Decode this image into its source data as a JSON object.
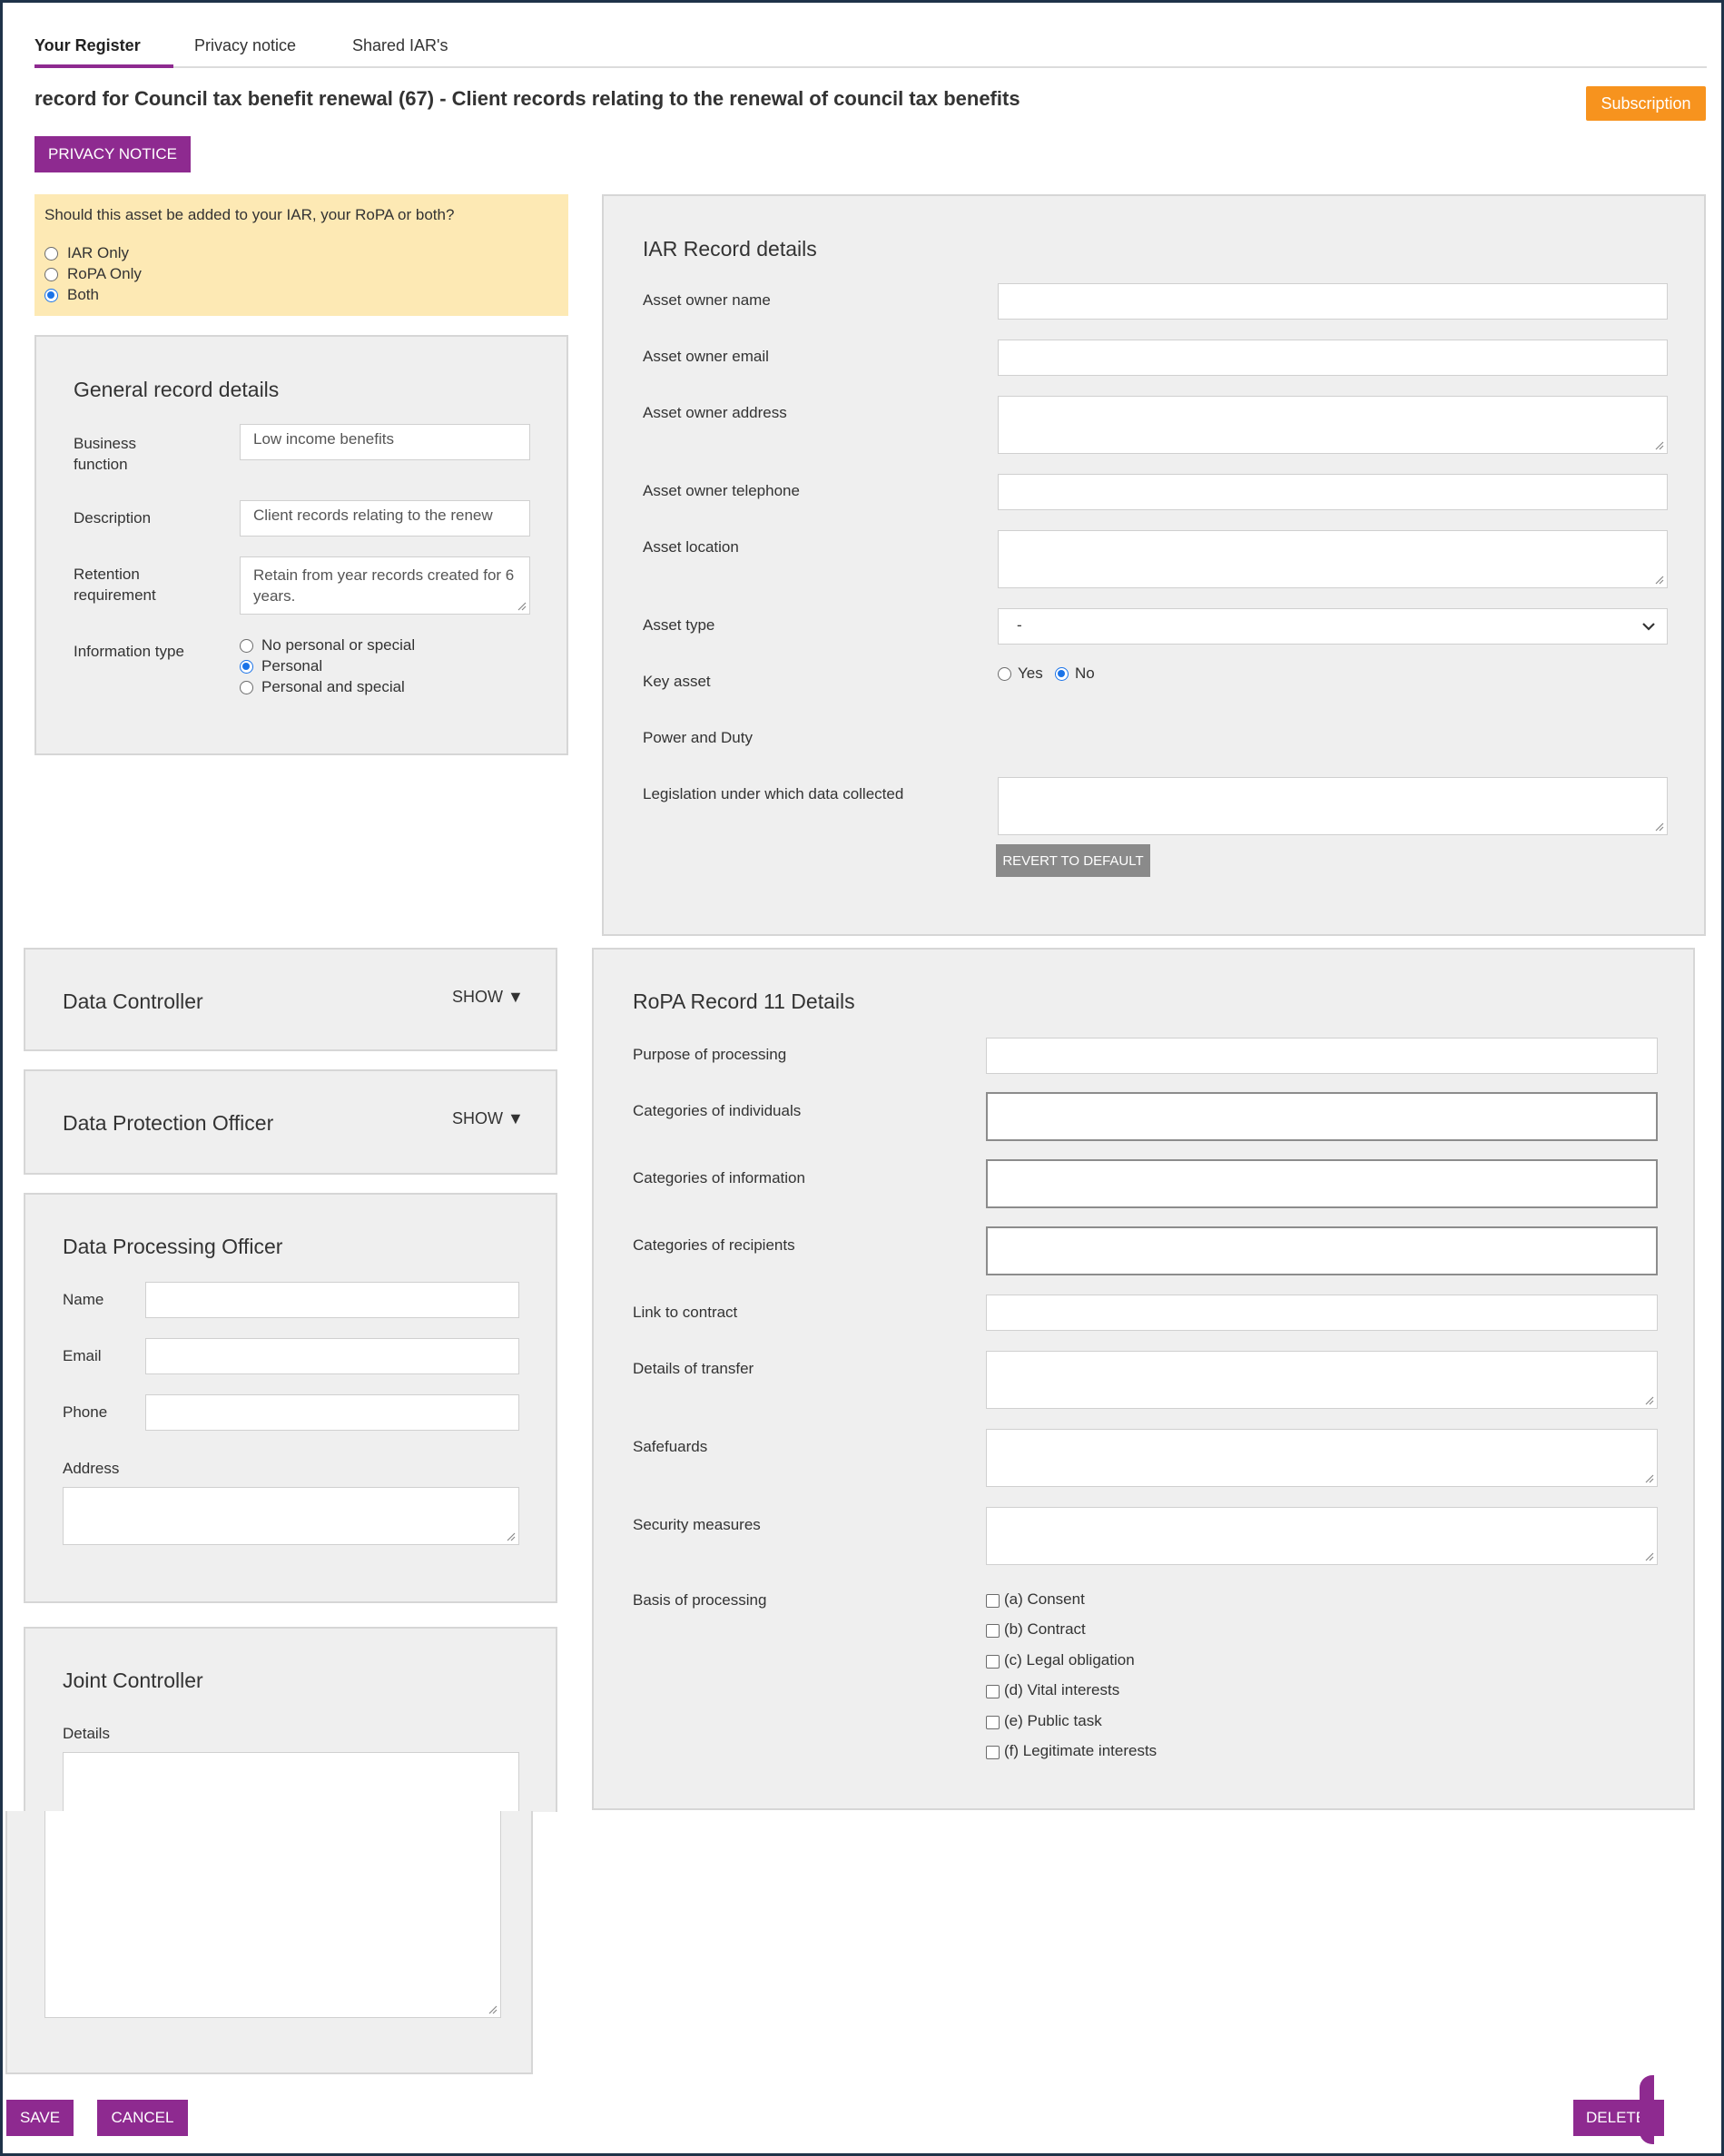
{
  "tabs": [
    "Your Register",
    "Privacy notice",
    "Shared IAR's"
  ],
  "page_title": "record for Council tax benefit renewal (67) - Client records relating to the renewal of council tax benefits",
  "subscription_button": "Subscription",
  "privacy_notice_button": "PRIVACY NOTICE",
  "asset_target": {
    "question": "Should this asset be added to your IAR, your RoPA or both?",
    "options": [
      "IAR Only",
      "RoPA Only",
      "Both"
    ],
    "selected": "Both"
  },
  "general": {
    "title": "General record details",
    "business_function_label": "Business function",
    "business_function_value": "Low income benefits",
    "description_label": "Description",
    "description_value": "Client records relating to the renew",
    "retention_label": "Retention requirement",
    "retention_value": "Retain from year records created for 6 years.",
    "info_type_label": "Information type",
    "info_type_options": [
      "No personal or special",
      "Personal",
      "Personal and special"
    ],
    "info_type_selected": "Personal"
  },
  "iar": {
    "title": "IAR Record details",
    "asset_owner_name": "Asset owner name",
    "asset_owner_email": "Asset owner email",
    "asset_owner_address": "Asset owner address",
    "asset_owner_telephone": "Asset owner telephone",
    "asset_location": "Asset location",
    "asset_type": "Asset type",
    "asset_type_value": "-",
    "key_asset": "Key asset",
    "key_asset_options": [
      "Yes",
      "No"
    ],
    "key_asset_selected": "No",
    "power_and_duty": "Power and Duty",
    "legislation": "Legislation under which data collected",
    "revert_button": "REVERT TO DEFAULT"
  },
  "data_controller": {
    "title": "Data Controller",
    "toggle": "SHOW ▼"
  },
  "dpo": {
    "title": "Data Protection Officer",
    "toggle": "SHOW ▼"
  },
  "processing_officer": {
    "title": "Data Processing Officer",
    "name": "Name",
    "email": "Email",
    "phone": "Phone",
    "address": "Address"
  },
  "joint_controller": {
    "title": "Joint Controller",
    "details": "Details"
  },
  "ropa": {
    "title": "RoPA Record 11 Details",
    "purpose": "Purpose of processing",
    "individuals": "Categories of individuals",
    "information": "Categories of information",
    "recipients": "Categories of recipients",
    "contract_link": "Link to contract",
    "transfer": "Details of transfer",
    "safeguards": "Safefuards",
    "security": "Security measures",
    "basis": "Basis of processing",
    "basis_options": [
      "(a) Consent",
      "(b) Contract",
      "(c) Legal obligation",
      "(d) Vital interests",
      "(e) Public task",
      "(f) Legitimate interests"
    ]
  },
  "footer": {
    "save": "SAVE",
    "cancel": "CANCEL",
    "delete": "DELETE"
  },
  "colors": {
    "brand_purple": "#8e2a90",
    "orange": "#f7931e",
    "notice_yellow": "#fde9b4",
    "panel_gray": "#efefef"
  }
}
